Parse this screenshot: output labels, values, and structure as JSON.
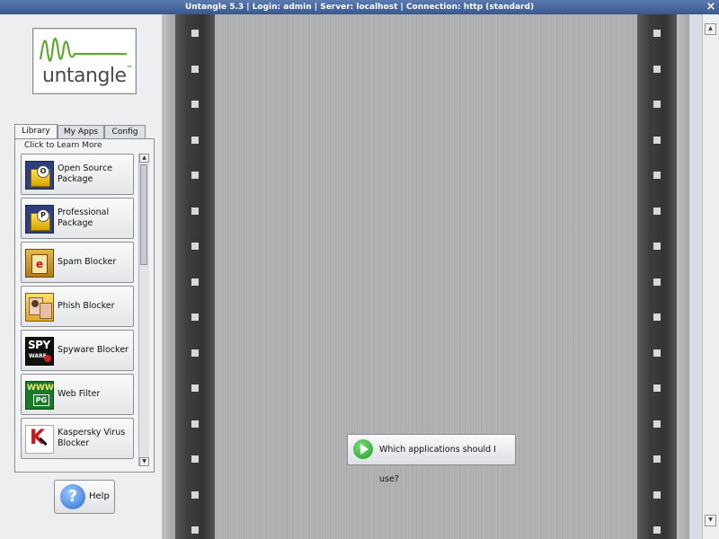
{
  "window": {
    "title": "Untangle 5.3  |  Login: admin  |  Server: localhost  |  Connection: http (standard)",
    "close_glyph": "×"
  },
  "logo": {
    "word": "untangle",
    "tm": "™",
    "accent_color": "#5fa832"
  },
  "tabs": [
    {
      "label": "Library",
      "active": true
    },
    {
      "label": "My Apps",
      "active": false
    },
    {
      "label": "Config",
      "active": false
    }
  ],
  "library": {
    "caption": "Click to Learn More",
    "items": [
      {
        "label": "Open Source Package",
        "icon": "open-source-package-icon",
        "badge": "O"
      },
      {
        "label": "Professional Package",
        "icon": "professional-package-icon",
        "badge": "P"
      },
      {
        "label": "Spam Blocker",
        "icon": "spam-blocker-icon",
        "badge": "e"
      },
      {
        "label": "Phish Blocker",
        "icon": "phish-blocker-icon",
        "badge": ""
      },
      {
        "label": "Spyware Blocker",
        "icon": "spyware-blocker-icon",
        "badge": "SPY",
        "badge2": "WARE"
      },
      {
        "label": "Web Filter",
        "icon": "web-filter-icon",
        "badge": "WWW",
        "badge2": "PG"
      },
      {
        "label": "Kaspersky Virus Blocker",
        "icon": "kaspersky-icon",
        "badge": "K"
      }
    ]
  },
  "help": {
    "label": "Help",
    "glyph": "?"
  },
  "main": {
    "which_label": "Which applications should I use?"
  },
  "scroll": {
    "up": "▲",
    "down": "▼"
  }
}
